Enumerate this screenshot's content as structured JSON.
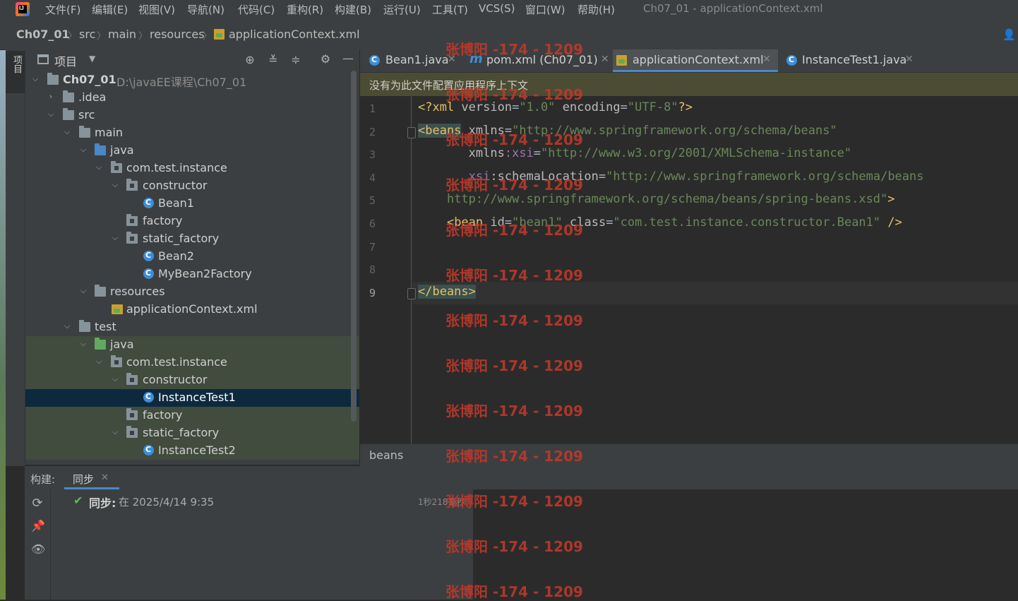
{
  "menubar": {
    "items": [
      "文件(F)",
      "编辑(E)",
      "视图(V)",
      "导航(N)",
      "代码(C)",
      "重构(R)",
      "构建(B)",
      "运行(U)",
      "工具(T)",
      "VCS(S)",
      "窗口(W)",
      "帮助(H)"
    ],
    "window_title": "Ch07_01 - applicationContext.xml"
  },
  "breadcrumb": {
    "project": "Ch07_01",
    "parts": [
      "src",
      "main",
      "resources"
    ],
    "file": "applicationContext.xml"
  },
  "side_strip": {
    "project_tab": "项目"
  },
  "project_panel": {
    "title": "项目",
    "tree": [
      {
        "label": "Ch07_01",
        "path": "D:\\javaEE课程\\Ch07_01",
        "icon": "module-folder-icon",
        "level": 0,
        "expanded": true
      },
      {
        "label": ".idea",
        "icon": "folder-icon",
        "level": 1,
        "expanded": false
      },
      {
        "label": "src",
        "icon": "folder-icon",
        "level": 1,
        "expanded": true
      },
      {
        "label": "main",
        "icon": "folder-icon",
        "level": 2,
        "expanded": true
      },
      {
        "label": "java",
        "icon": "source-folder-icon",
        "level": 3,
        "expanded": true
      },
      {
        "label": "com.test.instance",
        "icon": "package-icon",
        "level": 4,
        "expanded": true
      },
      {
        "label": "constructor",
        "icon": "package-icon",
        "level": 5,
        "expanded": true
      },
      {
        "label": "Bean1",
        "icon": "class-icon",
        "level": 6
      },
      {
        "label": "factory",
        "icon": "package-icon",
        "level": 5
      },
      {
        "label": "static_factory",
        "icon": "package-icon",
        "level": 5,
        "expanded": true
      },
      {
        "label": "Bean2",
        "icon": "class-icon",
        "level": 6
      },
      {
        "label": "MyBean2Factory",
        "icon": "class-icon",
        "level": 6
      },
      {
        "label": "resources",
        "icon": "resources-folder-icon",
        "level": 3,
        "expanded": true
      },
      {
        "label": "applicationContext.xml",
        "icon": "xml-file-icon",
        "level": 4
      },
      {
        "label": "test",
        "icon": "folder-icon",
        "level": 2,
        "expanded": true
      },
      {
        "label": "java",
        "icon": "test-folder-icon",
        "level": 3,
        "expanded": true
      },
      {
        "label": "com.test.instance",
        "icon": "package-icon",
        "level": 4,
        "expanded": true
      },
      {
        "label": "constructor",
        "icon": "package-icon",
        "level": 5,
        "expanded": true
      },
      {
        "label": "InstanceTest1",
        "icon": "test-class-icon",
        "level": 6,
        "selected": true
      },
      {
        "label": "factory",
        "icon": "package-icon",
        "level": 5
      },
      {
        "label": "static_factory",
        "icon": "package-icon",
        "level": 5,
        "expanded": true
      },
      {
        "label": "InstanceTest2",
        "icon": "class-icon",
        "level": 6
      }
    ]
  },
  "tabs": [
    {
      "label": "Bean1.java",
      "icon": "class-icon"
    },
    {
      "label": "pom.xml (Ch07_01)",
      "icon": "maven-icon"
    },
    {
      "label": "applicationContext.xml",
      "icon": "xml-file-icon",
      "active": true
    },
    {
      "label": "InstanceTest1.java",
      "icon": "test-class-icon"
    }
  ],
  "banner": {
    "text": "没有为此文件配置应用程序上下文"
  },
  "editor": {
    "line_numbers": [
      "1",
      "2",
      "3",
      "4",
      "5",
      "6",
      "7",
      "8",
      "9"
    ],
    "current_line": "9",
    "lines": [
      [
        [
          "pi",
          "<?xml "
        ],
        [
          "attr",
          "version"
        ],
        [
          "plain",
          "="
        ],
        [
          "val",
          "\"1.0\""
        ],
        [
          "attr",
          " encoding"
        ],
        [
          "plain",
          "="
        ],
        [
          "val",
          "\"UTF-8\""
        ],
        [
          "pi",
          "?>"
        ]
      ],
      [
        [
          "tag",
          "<beans"
        ],
        [
          "attr",
          " xmlns"
        ],
        [
          "plain",
          "="
        ],
        [
          "val",
          "\"http://www.springframework.org/schema/beans\""
        ]
      ],
      [
        [
          "plain",
          "       "
        ],
        [
          "attr",
          "xmlns"
        ],
        [
          "ns",
          ":xsi"
        ],
        [
          "plain",
          "="
        ],
        [
          "val",
          "\"http://www.w3.org/2001/XMLSchema-instance\""
        ]
      ],
      [
        [
          "plain",
          "       "
        ],
        [
          "ns",
          "xsi"
        ],
        [
          "attr",
          ":schemaLocation"
        ],
        [
          "plain",
          "="
        ],
        [
          "val",
          "\"http://www.springframework.org/schema/beans"
        ]
      ],
      [
        [
          "plain",
          "    "
        ],
        [
          "val",
          "http://www.springframework.org/schema/beans/spring-beans.xsd\""
        ],
        [
          "tag",
          ">"
        ]
      ],
      [
        [
          "plain",
          "    "
        ],
        [
          "tag",
          "<bean"
        ],
        [
          "attr",
          " id"
        ],
        [
          "plain",
          "="
        ],
        [
          "val",
          "\"bean1\""
        ],
        [
          "attr",
          " class"
        ],
        [
          "plain",
          "="
        ],
        [
          "val",
          "\"com.test.instance.constructor.Bean1\""
        ],
        [
          "tag",
          " />"
        ]
      ],
      [],
      [],
      [
        [
          "tag",
          "</beans>"
        ]
      ]
    ]
  },
  "editor_breadcrumb": {
    "text": "beans"
  },
  "build_panel": {
    "title": "构建:",
    "tab": "同步",
    "status_label": "同步:",
    "status_detail": "在 2025/4/14 9:35",
    "duration": "1秒218毫秒"
  },
  "watermark": {
    "text": "张博阳 -174 - 1209"
  },
  "colors": {
    "selection": "#0d293e",
    "test_highlight": "#414b3e",
    "banner": "#4b4c33",
    "watermark": "#c0392b",
    "accent": "#4a88c7"
  }
}
